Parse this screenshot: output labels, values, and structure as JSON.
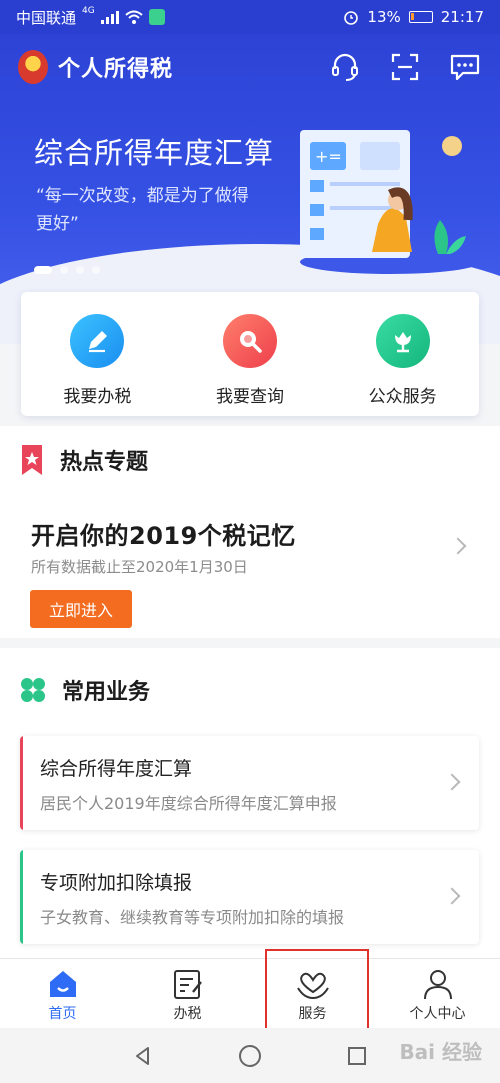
{
  "status_bar": {
    "carrier": "中国联通",
    "network": "4G",
    "battery": "13%",
    "time": "21:17"
  },
  "header": {
    "app_title": "个人所得税"
  },
  "banner": {
    "title": "综合所得年度汇算",
    "subtitle": "“每一次改变，都是为了做得更好”",
    "slide_count": 4,
    "active_slide": 1
  },
  "quick_actions": [
    {
      "label": "我要办税",
      "icon": "edit-icon",
      "color": "#21a9f3"
    },
    {
      "label": "我要查询",
      "icon": "search-icon",
      "color": "#f25c58"
    },
    {
      "label": "公众服务",
      "icon": "flower-icon",
      "color": "#21c58f"
    }
  ],
  "hot_topics": {
    "section_title": "热点专题",
    "card_title": "开启你的2019个税记忆",
    "card_subtitle": "所有数据截止至2020年1月30日",
    "button_label": "立即进入"
  },
  "common_business": {
    "section_title": "常用业务",
    "items": [
      {
        "title": "综合所得年度汇算",
        "subtitle": "居民个人2019年度综合所得年度汇算申报",
        "accent": "#e8455a"
      },
      {
        "title": "专项附加扣除填报",
        "subtitle": "子女教育、继续教育等专项附加扣除的填报",
        "accent": "#2bc58a"
      }
    ]
  },
  "tabs": [
    {
      "label": "首页",
      "icon": "home-icon",
      "active": true
    },
    {
      "label": "办税",
      "icon": "tax-form-icon",
      "active": false
    },
    {
      "label": "服务",
      "icon": "service-heart-icon",
      "active": false
    },
    {
      "label": "个人中心",
      "icon": "user-icon",
      "active": false
    }
  ],
  "watermark": "Bai 经验"
}
